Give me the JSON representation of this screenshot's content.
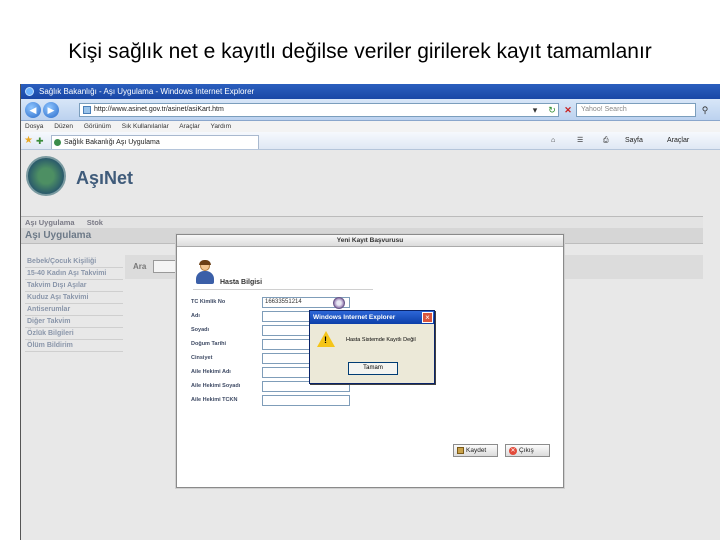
{
  "caption": "Kişi sağlık net e kayıtlı değilse veriler girilerek kayıt tamamlanır",
  "window": {
    "title": "Sağlık Bakanlığı - Aşı Uygulama - Windows Internet Explorer"
  },
  "browser": {
    "url": "http://www.asinet.gov.tr/asinet/asiKart.htm",
    "search_placeholder": "Yahoo! Search",
    "menu": [
      "Dosya",
      "Düzen",
      "Görünüm",
      "Sık Kullanılanlar",
      "Araçlar",
      "Yardım"
    ],
    "tab_title": "Sağlık Bakanlığı Aşı Uygulama",
    "cmd_page": "Sayfa",
    "cmd_tools": "Araçlar"
  },
  "app": {
    "brand": "AşıNet",
    "nav": [
      "Aşı Uygulama",
      "Stok"
    ],
    "section_title": "Aşı Uygulama",
    "sidebar": [
      "Bebek/Çocuk Kişiliği",
      "15-40 Kadın Aşı Takvimi",
      "Takvim Dışı Aşılar",
      "Kuduz Aşı Takvimi",
      "Antiserumlar",
      "Diğer Takvim",
      "Özlük Bilgileri",
      "Ölüm Bildirim"
    ],
    "search_label": "Ara"
  },
  "modal": {
    "title": "Yeni Kayıt Başvurusu",
    "section_title": "Hasta Bilgisi",
    "fields": [
      {
        "label": "TC Kimlik No",
        "value": "16633551214"
      },
      {
        "label": "Adı",
        "value": ""
      },
      {
        "label": "Soyadı",
        "value": ""
      },
      {
        "label": "Doğum Tarihi",
        "value": ""
      },
      {
        "label": "Cinsiyet",
        "value": ""
      },
      {
        "label": "Aile Hekimi Adı",
        "value": ""
      },
      {
        "label": "Aile Hekimi Soyadı",
        "value": ""
      },
      {
        "label": "Aile Hekimi TCKN",
        "value": ""
      }
    ],
    "save_label": "Kaydet",
    "exit_label": "Çıkış"
  },
  "alert": {
    "title": "Windows Internet Explorer",
    "message": "Hasta Sistemde Kayıtlı Değil",
    "ok_label": "Tamam"
  }
}
